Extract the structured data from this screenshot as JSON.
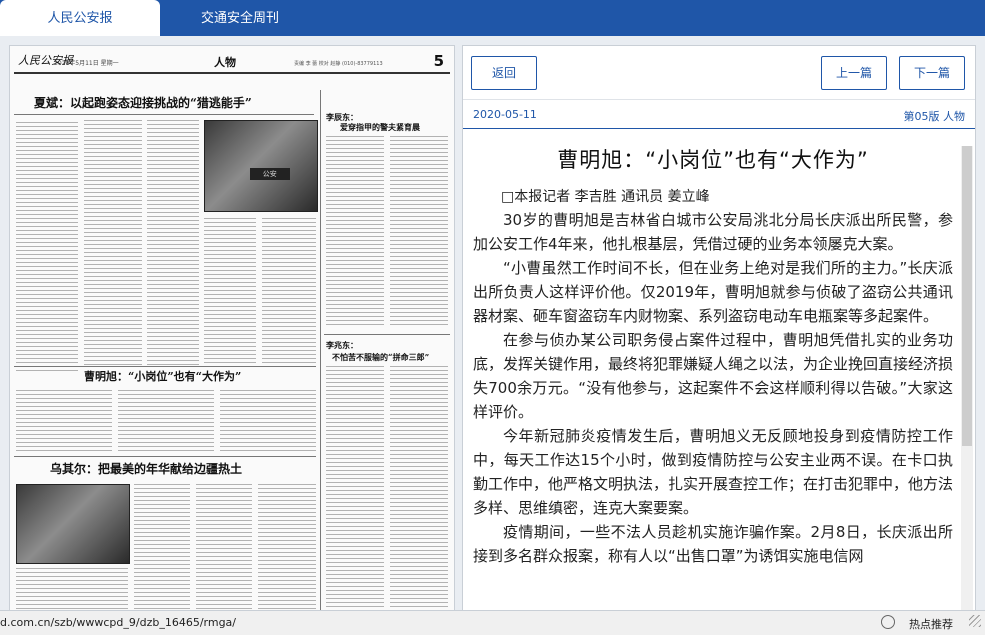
{
  "tabs": [
    {
      "label": "人民公安报"
    },
    {
      "label": "交通安全周刊"
    }
  ],
  "paper": {
    "masthead_logo": "人民公安报",
    "masthead_date": "2020年5月11日 星期一",
    "section": "人物",
    "meta": "责编 李 蕾 校对 赵静 (010)-83779113",
    "page_number": "5",
    "headline_1": "夏斌：以起跑姿态迎接挑战的“猎逃能手”",
    "headline_2": "曹明旭：“小岗位”也有“大作为”",
    "headline_3": "乌其尔：把最美的年华献给边疆热土",
    "side_1_lead": "李辰东：",
    "side_1_title": "爱穿指甲的警夫紧育晨",
    "side_2_lead": "李兆东：",
    "side_2_title": "不怕苦不服输的“拼命三郎”",
    "photo_label": "公安"
  },
  "reader": {
    "back": "返回",
    "prev": "上一篇",
    "next": "下一篇",
    "date": "2020-05-11",
    "edition": "第05版 人物",
    "title": "曹明旭：“小岗位”也有“大作为”",
    "byline": "□本报记者 李吉胜 通讯员 姜立峰",
    "paragraphs": [
      "30岁的曹明旭是吉林省白城市公安局洮北分局长庆派出所民警，参加公安工作4年来，他扎根基层，凭借过硬的业务本领屡克大案。",
      "“小曹虽然工作时间不长，但在业务上绝对是我们所的主力。”长庆派出所负责人这样评价他。仅2019年，曹明旭就参与侦破了盗窃公共通讯器材案、砸车窗盗窃车内财物案、系列盗窃电动车电瓶案等多起案件。",
      "在参与侦办某公司职务侵占案件过程中，曹明旭凭借扎实的业务功底，发挥关键作用，最终将犯罪嫌疑人绳之以法，为企业挽回直接经济损失700余万元。“没有他参与，这起案件不会这样顺利得以告破。”大家这样评价。",
      "今年新冠肺炎疫情发生后，曹明旭义无反顾地投身到疫情防控工作中，每天工作达15个小时，做到疫情防控与公安主业两不误。在卡口执勤工作中，他严格文明执法，扎实开展查控工作；在打击犯罪中，他方法多样、思维缜密，连克大案要案。",
      "疫情期间，一些不法人员趁机实施诈骗作案。2月8日，长庆派出所接到多名群众报案，称有人以“出售口罩”为诱饵实施电信网"
    ]
  },
  "status": {
    "url": "d.com.cn/szb/wwwcpd_9/dzb_16465/rmga/",
    "hot": "热点推荐"
  }
}
